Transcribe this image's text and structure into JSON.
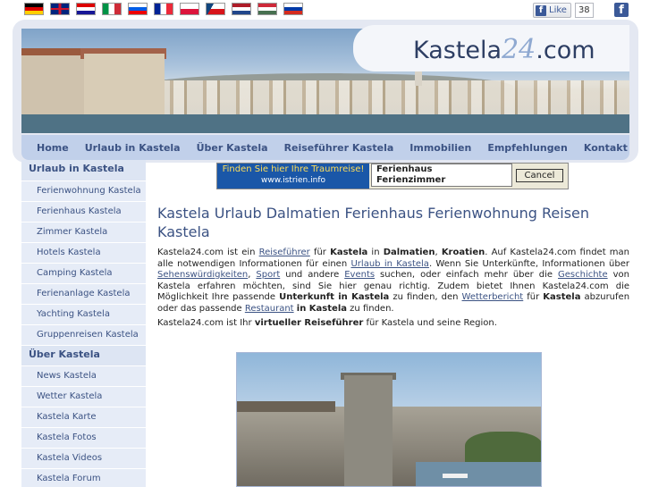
{
  "topbar": {
    "flags": [
      "flag-de",
      "flag-gb",
      "flag-hr",
      "flag-it",
      "flag-si",
      "flag-fr",
      "flag-pl",
      "flag-cz",
      "flag-nl",
      "flag-hu",
      "flag-ru"
    ],
    "fb_like_label": "Like",
    "fb_like_count": "38",
    "fb_icon_glyph": "f"
  },
  "header": {
    "logo_prefix": "Kastela",
    "logo_number": "24",
    "logo_suffix": ".com"
  },
  "nav": {
    "items": [
      "Home",
      "Urlaub in Kastela",
      "Über Kastela",
      "Reiseführer Kastela",
      "Immobilien",
      "Empfehlungen",
      "Kontakt"
    ]
  },
  "sidebar": {
    "section1": "Urlaub in Kastela",
    "items1": [
      "Ferienwohnung Kastela",
      "Ferienhaus Kastela",
      "Zimmer Kastela",
      "Hotels Kastela",
      "Camping Kastela",
      "Ferienanlage Kastela",
      "Yachting Kastela",
      "Gruppenreisen Kastela"
    ],
    "section2": "Über Kastela",
    "items2": [
      "News Kastela",
      "Wetter Kastela",
      "Kastela Karte",
      "Kastela Fotos",
      "Kastela Videos",
      "Kastela Forum"
    ]
  },
  "ad": {
    "line1": "Finden Sie hier Ihre Traumreise!",
    "line2": "www.istrien.info",
    "options": [
      "Ferienhaus",
      "Ferienzimmer"
    ],
    "cancel": "Cancel"
  },
  "main": {
    "title": "Kastela Urlaub Dalmatien Ferienhaus Ferienwohnung Reisen Kastela",
    "p1": {
      "t1": "Kastela24.com ist ein ",
      "l1": "Reiseführer",
      "t2": " für ",
      "b1": "Kastela",
      "t3": " in ",
      "b2": "Dalmatien",
      "t4": ", ",
      "b3": "Kroatien",
      "t5": ". Auf Kastela24.com findet man alle notwendigen Informationen für einen ",
      "l2": "Urlaub in Kastela",
      "t6": ". Wenn Sie Unterkünfte, Informationen über ",
      "l3": "Sehenswürdigkeiten",
      "t7": ", ",
      "l4": "Sport",
      "t8": " und andere ",
      "l5": "Events",
      "t9": " suchen, oder einfach mehr über die ",
      "l6": "Geschichte",
      "t10": " von Kastela erfahren möchten, sind Sie hier genau richtig. Zudem bietet Ihnen Kastela24.com die Möglichkeit Ihre passende ",
      "b4": "Unterkunft in Kastela",
      "t11": " zu finden, den ",
      "l7": "Wetterbericht",
      "t12": " für ",
      "b5": "Kastela",
      "t13": " abzurufen oder das passende ",
      "l8": "Restaurant",
      "t14": " ",
      "b6": "in Kastela",
      "t15": " zu finden."
    },
    "p2": {
      "t1": "Kastela24.com ist Ihr ",
      "b1": "virtueller Reiseführer",
      "t2": " für Kastela und seine Region."
    }
  },
  "colors": {
    "nav_bg": "#c1d0ea",
    "link": "#3b5283",
    "sidebar_bg": "#dde5f3",
    "header_bg": "#e4e8f2",
    "facebook": "#3b5998"
  }
}
